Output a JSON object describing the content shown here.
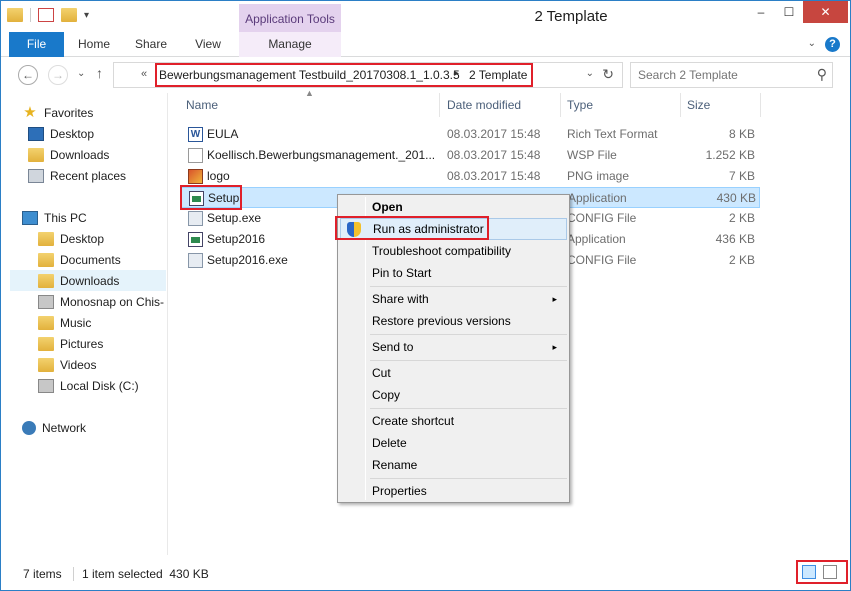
{
  "window": {
    "title": "2 Template",
    "context_tab_group": "Application Tools",
    "controls": {
      "minimize": "–",
      "maximize": "☐",
      "close": "✕"
    }
  },
  "ribbon": {
    "tabs": [
      "File",
      "Home",
      "Share",
      "View",
      "Manage"
    ],
    "help": "?",
    "collapse": "⌄"
  },
  "address": {
    "overflow": "«",
    "crumbs": [
      "Bewerbungsmanagement Testbuild_20170308.1_1.0.3.5",
      "2 Template"
    ],
    "separator": "▸",
    "dropdown": "⌄",
    "refresh": "↻"
  },
  "nav_buttons": {
    "back": "←",
    "forward": "→",
    "up_list": "⌄",
    "up": "↑"
  },
  "search": {
    "placeholder": "Search 2 Template",
    "icon": "⚲"
  },
  "nav_pane": {
    "items": [
      {
        "label": "Favorites",
        "icon": "star-icon",
        "group": true
      },
      {
        "label": "Desktop",
        "icon": "desktop-icon"
      },
      {
        "label": "Downloads",
        "icon": "folder-icon"
      },
      {
        "label": "Recent places",
        "icon": "recent-places-icon"
      },
      {
        "label": "This PC",
        "icon": "pc-icon",
        "group": true
      },
      {
        "label": "Desktop",
        "icon": "folder-icon"
      },
      {
        "label": "Documents",
        "icon": "folder-icon"
      },
      {
        "label": "Downloads",
        "icon": "folder-icon",
        "selected": true
      },
      {
        "label": "Monosnap on Chis-",
        "icon": "network-drive-icon"
      },
      {
        "label": "Music",
        "icon": "folder-icon"
      },
      {
        "label": "Pictures",
        "icon": "folder-icon"
      },
      {
        "label": "Videos",
        "icon": "folder-icon"
      },
      {
        "label": "Local Disk (C:)",
        "icon": "disk-icon"
      },
      {
        "label": "Network",
        "icon": "network-icon",
        "group": true
      }
    ]
  },
  "columns": {
    "name": "Name",
    "date": "Date modified",
    "type": "Type",
    "size": "Size",
    "sort_indicator": "▲"
  },
  "files": [
    {
      "name": "EULA",
      "date": "08.03.2017 15:48",
      "type": "Rich Text Format",
      "size": "8 KB",
      "icon": "word-doc-icon"
    },
    {
      "name": "Koellisch.Bewerbungsmanagement._201...",
      "date": "08.03.2017 15:48",
      "type": "WSP File",
      "size": "1.252 KB",
      "icon": "file-icon"
    },
    {
      "name": "logo",
      "date": "08.03.2017 15:48",
      "type": "PNG image",
      "size": "7 KB",
      "icon": "image-icon"
    },
    {
      "name": "Setup",
      "date": "",
      "type": "Application",
      "size": "430 KB",
      "icon": "application-icon",
      "selected": true
    },
    {
      "name": "Setup.exe",
      "date": "",
      "type": "CONFIG File",
      "size": "2 KB",
      "icon": "config-icon"
    },
    {
      "name": "Setup2016",
      "date": "",
      "type": "Application",
      "size": "436 KB",
      "icon": "application-icon"
    },
    {
      "name": "Setup2016.exe",
      "date": "",
      "type": "CONFIG File",
      "size": "2 KB",
      "icon": "config-icon"
    }
  ],
  "context_menu": {
    "items": [
      {
        "label": "Open",
        "bold": true
      },
      {
        "label": "Run as administrator",
        "icon": "uac-shield-icon",
        "hover": true
      },
      {
        "label": "Troubleshoot compatibility"
      },
      {
        "label": "Pin to Start"
      },
      {
        "separator": true
      },
      {
        "label": "Share with",
        "submenu": true
      },
      {
        "label": "Restore previous versions"
      },
      {
        "separator": true
      },
      {
        "label": "Send to",
        "submenu": true
      },
      {
        "separator": true
      },
      {
        "label": "Cut"
      },
      {
        "label": "Copy"
      },
      {
        "separator": true
      },
      {
        "label": "Create shortcut"
      },
      {
        "label": "Delete"
      },
      {
        "label": "Rename"
      },
      {
        "separator": true
      },
      {
        "label": "Properties"
      }
    ],
    "submenu_arrow": "▸"
  },
  "status": {
    "items_count": "7 items",
    "selection": "1 item selected  430 KB"
  },
  "colors": {
    "accent": "#1979ca",
    "highlight_red": "#e0202a",
    "selection": "#cce8ff",
    "context_tab": "#e4d2ee"
  }
}
